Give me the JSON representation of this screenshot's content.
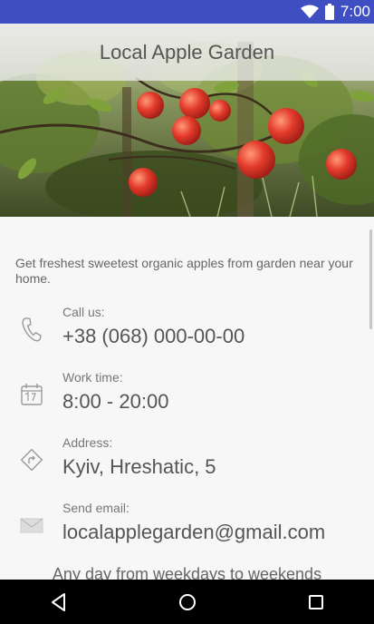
{
  "status_bar": {
    "time": "7:00",
    "icons": [
      "wifi-icon",
      "battery-icon"
    ],
    "color": "#3f4ec0"
  },
  "app_bar": {
    "title": "Local Apple Garden"
  },
  "hero": {
    "icon": "apple-orchard-photo"
  },
  "content": {
    "tagline": "Get freshest sweetest organic apples from garden near your home.",
    "items": [
      {
        "icon": "phone-icon",
        "label": "Call us:",
        "value": "+38 (068) 000-00-00"
      },
      {
        "icon": "calendar-icon",
        "label": "Work time:",
        "value": "8:00 - 20:00"
      },
      {
        "icon": "directions-icon",
        "label": "Address:",
        "value": "Kyiv, Hreshatic, 5"
      },
      {
        "icon": "email-icon",
        "label": "Send email:",
        "value": "localapplegarden@gmail.com"
      }
    ],
    "footer": "Any day from weekdays to weekends"
  },
  "nav_bar": {
    "buttons": [
      "back-icon",
      "home-icon",
      "recents-icon"
    ]
  }
}
